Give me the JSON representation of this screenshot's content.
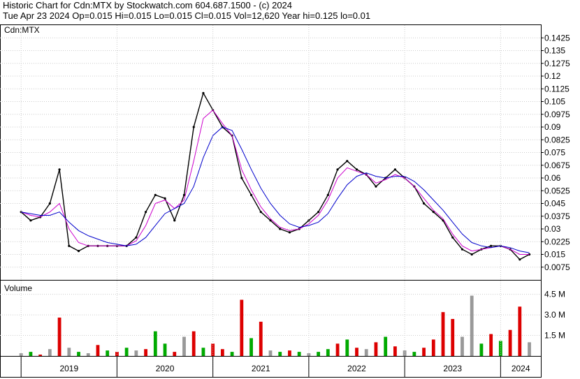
{
  "header": {
    "line1": "Historic Chart for Cdn:MTX by Stockwatch.com 604.687.1500 - (c) 2024",
    "line2": "Tue Apr 23 2024   Op=0.015   Hi=0.015   Lo=0.015   Cl=0.015   Vol=12,620   Year hi=0.125   lo=0.01"
  },
  "colors": {
    "price": "#000000",
    "ma_short": "#cc00cc",
    "ma_long": "#0000cc",
    "vol_up": "#00aa00",
    "vol_down": "#dd0000",
    "vol_flat": "#999999",
    "grid": "#cccccc"
  },
  "chart_data": [
    {
      "type": "line",
      "title": "Cdn:MTX",
      "ylim": [
        0,
        0.15
      ],
      "yticks": [
        "0.0075",
        "0.015",
        "0.0225",
        "0.03",
        "0.0375",
        "0.045",
        "0.0525",
        "0.06",
        "0.0675",
        "0.075",
        "0.0825",
        "0.09",
        "0.0975",
        "0.105",
        "0.1125",
        "0.12",
        "0.1275",
        "0.135",
        "0.1425"
      ],
      "x": [
        2019.0,
        2019.1,
        2019.2,
        2019.3,
        2019.4,
        2019.5,
        2019.6,
        2019.7,
        2019.8,
        2019.9,
        2020.0,
        2020.1,
        2020.2,
        2020.3,
        2020.4,
        2020.5,
        2020.6,
        2020.7,
        2020.8,
        2020.9,
        2021.0,
        2021.1,
        2021.2,
        2021.3,
        2021.4,
        2021.5,
        2021.6,
        2021.7,
        2021.8,
        2021.9,
        2022.0,
        2022.1,
        2022.2,
        2022.3,
        2022.4,
        2022.5,
        2022.6,
        2022.7,
        2022.8,
        2022.9,
        2023.0,
        2023.1,
        2023.2,
        2023.3,
        2023.4,
        2023.5,
        2023.6,
        2023.7,
        2023.8,
        2023.9,
        2024.0,
        2024.1,
        2024.2,
        2024.3
      ],
      "series": [
        {
          "values": [
            0.04,
            0.035,
            0.037,
            0.045,
            0.065,
            0.02,
            0.017,
            0.02,
            0.02,
            0.02,
            0.02,
            0.02,
            0.025,
            0.04,
            0.05,
            0.048,
            0.035,
            0.05,
            0.09,
            0.11,
            0.1,
            0.09,
            0.085,
            0.06,
            0.05,
            0.04,
            0.035,
            0.03,
            0.028,
            0.03,
            0.035,
            0.04,
            0.05,
            0.065,
            0.07,
            0.065,
            0.062,
            0.055,
            0.06,
            0.065,
            0.06,
            0.055,
            0.045,
            0.04,
            0.035,
            0.025,
            0.018,
            0.015,
            0.018,
            0.02,
            0.02,
            0.018,
            0.012,
            0.015
          ]
        },
        {
          "values": [
            0.04,
            0.038,
            0.037,
            0.04,
            0.045,
            0.03,
            0.022,
            0.02,
            0.02,
            0.02,
            0.02,
            0.02,
            0.023,
            0.032,
            0.045,
            0.047,
            0.042,
            0.047,
            0.07,
            0.095,
            0.1,
            0.092,
            0.085,
            0.065,
            0.053,
            0.043,
            0.036,
            0.031,
            0.029,
            0.03,
            0.033,
            0.038,
            0.047,
            0.06,
            0.066,
            0.064,
            0.062,
            0.057,
            0.059,
            0.062,
            0.06,
            0.055,
            0.048,
            0.041,
            0.036,
            0.027,
            0.02,
            0.017,
            0.018,
            0.019,
            0.02,
            0.018,
            0.015,
            0.015
          ]
        },
        {
          "values": [
            0.04,
            0.039,
            0.038,
            0.038,
            0.04,
            0.034,
            0.029,
            0.026,
            0.024,
            0.022,
            0.021,
            0.02,
            0.021,
            0.025,
            0.032,
            0.039,
            0.042,
            0.045,
            0.055,
            0.072,
            0.085,
            0.09,
            0.088,
            0.077,
            0.065,
            0.054,
            0.045,
            0.038,
            0.033,
            0.031,
            0.032,
            0.034,
            0.039,
            0.048,
            0.056,
            0.061,
            0.063,
            0.061,
            0.06,
            0.061,
            0.061,
            0.058,
            0.053,
            0.047,
            0.041,
            0.034,
            0.027,
            0.022,
            0.02,
            0.019,
            0.02,
            0.019,
            0.017,
            0.016
          ]
        }
      ]
    },
    {
      "type": "bar",
      "title": "Volume",
      "yticks": [
        "1.5 M",
        "3.0 M",
        "4.5 M"
      ],
      "ylim": [
        0,
        5.5
      ],
      "xticks": [
        "2019",
        "2020",
        "2021",
        "2022",
        "2023",
        "2024"
      ],
      "x": [
        2019.0,
        2019.1,
        2019.2,
        2019.3,
        2019.4,
        2019.5,
        2019.6,
        2019.7,
        2019.8,
        2019.9,
        2020.0,
        2020.1,
        2020.2,
        2020.3,
        2020.4,
        2020.5,
        2020.6,
        2020.7,
        2020.8,
        2020.9,
        2021.0,
        2021.1,
        2021.2,
        2021.3,
        2021.4,
        2021.5,
        2021.6,
        2021.7,
        2021.8,
        2021.9,
        2022.0,
        2022.1,
        2022.2,
        2022.3,
        2022.4,
        2022.5,
        2022.6,
        2022.7,
        2022.8,
        2022.9,
        2023.0,
        2023.1,
        2023.2,
        2023.3,
        2023.4,
        2023.5,
        2023.6,
        2023.7,
        2023.8,
        2023.9,
        2024.0,
        2024.1,
        2024.2,
        2024.3
      ],
      "values": [
        0.2,
        0.3,
        0.1,
        0.5,
        2.8,
        0.6,
        0.3,
        0.2,
        0.8,
        0.4,
        0.3,
        0.6,
        0.4,
        0.5,
        1.8,
        0.9,
        0.3,
        1.4,
        1.8,
        0.6,
        0.9,
        0.5,
        0.3,
        4.1,
        1.3,
        2.5,
        0.4,
        0.3,
        0.4,
        0.3,
        0.2,
        0.3,
        0.5,
        0.9,
        1.2,
        0.6,
        0.5,
        1.0,
        1.4,
        0.7,
        0.4,
        0.3,
        0.6,
        1.2,
        3.2,
        2.7,
        1.4,
        4.4,
        0.9,
        1.6,
        1.1,
        1.9,
        3.6,
        1.0
      ],
      "direction": [
        "flat",
        "up",
        "down",
        "flat",
        "down",
        "flat",
        "up",
        "flat",
        "down",
        "up",
        "down",
        "up",
        "flat",
        "down",
        "up",
        "up",
        "down",
        "flat",
        "down",
        "up",
        "down",
        "down",
        "up",
        "down",
        "up",
        "down",
        "flat",
        "up",
        "down",
        "up",
        "flat",
        "up",
        "up",
        "down",
        "up",
        "down",
        "flat",
        "down",
        "up",
        "down",
        "flat",
        "up",
        "down",
        "down",
        "down",
        "down",
        "flat",
        "flat",
        "up",
        "down",
        "up",
        "down",
        "down",
        "flat"
      ]
    }
  ]
}
